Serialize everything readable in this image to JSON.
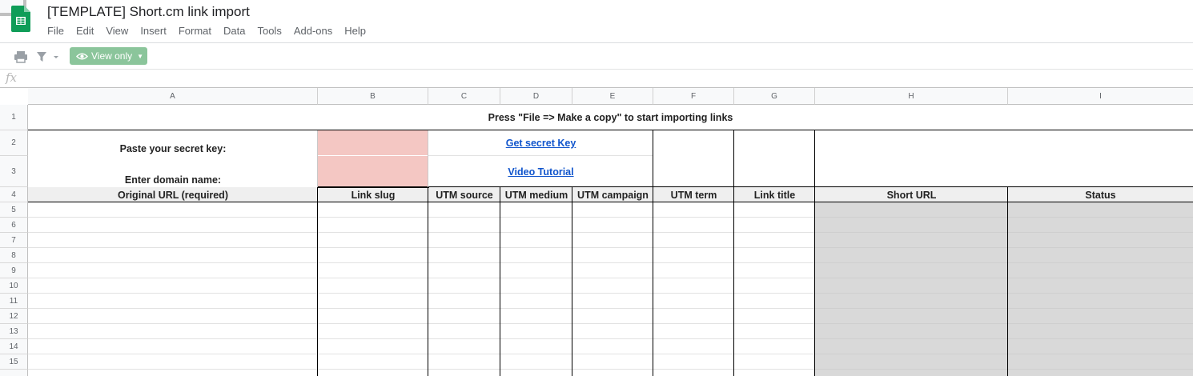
{
  "app": {
    "title": "[TEMPLATE] Short.cm link import",
    "menu": [
      "File",
      "Edit",
      "View",
      "Insert",
      "Format",
      "Data",
      "Tools",
      "Add-ons",
      "Help"
    ]
  },
  "toolbar": {
    "view_only_label": "View only"
  },
  "formula_bar": {
    "fx_label": "fx",
    "value": ""
  },
  "colors": {
    "sheets_green": "#0f9d58",
    "view_only_bg": "#8bc59b",
    "input_cell_pink": "#f4c7c3",
    "output_cell_gray": "#d9d9d9",
    "link_blue": "#1155cc"
  },
  "sheet": {
    "columns": [
      "A",
      "B",
      "C",
      "D",
      "E",
      "F",
      "G",
      "H",
      "I"
    ],
    "row_numbers": [
      "1",
      "2",
      "3",
      "4",
      "5",
      "6",
      "7",
      "8",
      "9",
      "10",
      "11",
      "12",
      "13",
      "14",
      "15"
    ],
    "banner": "Press \"File => Make a copy\" to start importing links",
    "secret_key_label": "Paste your secret key:",
    "domain_label": "Enter domain name:",
    "get_secret_key_link": "Get secret Key",
    "video_tutorial_link": "Video Tutorial",
    "headers": [
      "Original URL (required)",
      "Link slug",
      "UTM source",
      "UTM medium",
      "UTM campaign",
      "UTM term",
      "Link title",
      "Short URL",
      "Status"
    ]
  }
}
